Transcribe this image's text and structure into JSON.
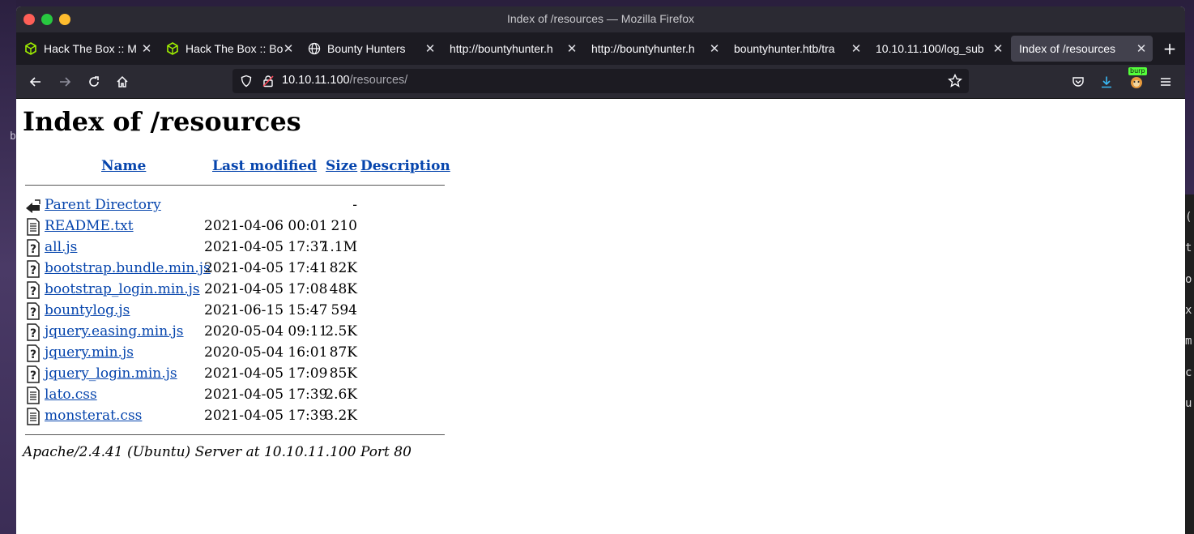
{
  "window": {
    "title": "Index of /resources — Mozilla Firefox"
  },
  "tabs": [
    {
      "label": "Hack The Box :: M",
      "icon": "htb-cube-icon"
    },
    {
      "label": "Hack The Box :: Bo",
      "icon": "htb-cube-icon"
    },
    {
      "label": "Bounty Hunters",
      "icon": "globe-icon"
    },
    {
      "label": "http://bountyhunter.h",
      "icon": ""
    },
    {
      "label": "http://bountyhunter.h",
      "icon": ""
    },
    {
      "label": "bountyhunter.htb/tra",
      "icon": ""
    },
    {
      "label": "10.10.11.100/log_sub",
      "icon": ""
    },
    {
      "label": "Index of /resources",
      "icon": "",
      "active": true
    }
  ],
  "navbar": {
    "url_host": "10.10.11.100",
    "url_path": "/resources/",
    "burp_badge": "burp"
  },
  "page": {
    "heading": "Index of /resources",
    "columns": {
      "name": "Name",
      "last_modified": "Last modified",
      "size": "Size",
      "description": "Description"
    },
    "parent": {
      "name": "Parent Directory",
      "size": "-"
    },
    "files": [
      {
        "name": "README.txt",
        "modified": "2021-04-06 00:01",
        "size": "210",
        "icon": "text-file-icon"
      },
      {
        "name": "all.js",
        "modified": "2021-04-05 17:37",
        "size": "1.1M",
        "icon": "unknown-file-icon"
      },
      {
        "name": "bootstrap.bundle.min.js",
        "modified": "2021-04-05 17:41",
        "size": "82K",
        "icon": "unknown-file-icon"
      },
      {
        "name": "bootstrap_login.min.js",
        "modified": "2021-04-05 17:08",
        "size": "48K",
        "icon": "unknown-file-icon"
      },
      {
        "name": "bountylog.js",
        "modified": "2021-06-15 15:47",
        "size": "594",
        "icon": "unknown-file-icon"
      },
      {
        "name": "jquery.easing.min.js",
        "modified": "2020-05-04 09:11",
        "size": "2.5K",
        "icon": "unknown-file-icon"
      },
      {
        "name": "jquery.min.js",
        "modified": "2020-05-04 16:01",
        "size": "87K",
        "icon": "unknown-file-icon"
      },
      {
        "name": "jquery_login.min.js",
        "modified": "2021-04-05 17:09",
        "size": "85K",
        "icon": "unknown-file-icon"
      },
      {
        "name": "lato.css",
        "modified": "2021-04-05 17:39",
        "size": "2.6K",
        "icon": "text-file-icon"
      },
      {
        "name": "monsterat.css",
        "modified": "2021-04-05 17:39",
        "size": "3.2K",
        "icon": "text-file-icon"
      }
    ],
    "footer": "Apache/2.4.41 (Ubuntu) Server at 10.10.11.100 Port 80"
  },
  "desktop": {
    "left_char": "b",
    "terminal_chars": [
      "(",
      "t",
      "o",
      "x",
      "m",
      "c",
      "u"
    ]
  }
}
